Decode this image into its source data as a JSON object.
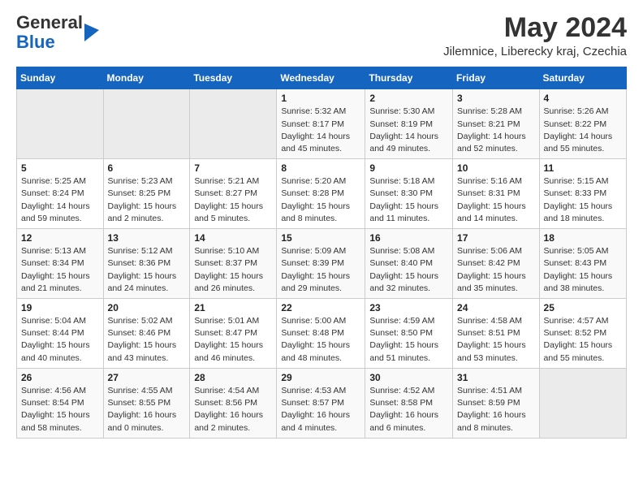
{
  "header": {
    "logo_general": "General",
    "logo_blue": "Blue",
    "month_year": "May 2024",
    "location": "Jilemnice, Liberecky kraj, Czechia"
  },
  "days_of_week": [
    "Sunday",
    "Monday",
    "Tuesday",
    "Wednesday",
    "Thursday",
    "Friday",
    "Saturday"
  ],
  "weeks": [
    [
      {
        "day": "",
        "info": ""
      },
      {
        "day": "",
        "info": ""
      },
      {
        "day": "",
        "info": ""
      },
      {
        "day": "1",
        "info": "Sunrise: 5:32 AM\nSunset: 8:17 PM\nDaylight: 14 hours\nand 45 minutes."
      },
      {
        "day": "2",
        "info": "Sunrise: 5:30 AM\nSunset: 8:19 PM\nDaylight: 14 hours\nand 49 minutes."
      },
      {
        "day": "3",
        "info": "Sunrise: 5:28 AM\nSunset: 8:21 PM\nDaylight: 14 hours\nand 52 minutes."
      },
      {
        "day": "4",
        "info": "Sunrise: 5:26 AM\nSunset: 8:22 PM\nDaylight: 14 hours\nand 55 minutes."
      }
    ],
    [
      {
        "day": "5",
        "info": "Sunrise: 5:25 AM\nSunset: 8:24 PM\nDaylight: 14 hours\nand 59 minutes."
      },
      {
        "day": "6",
        "info": "Sunrise: 5:23 AM\nSunset: 8:25 PM\nDaylight: 15 hours\nand 2 minutes."
      },
      {
        "day": "7",
        "info": "Sunrise: 5:21 AM\nSunset: 8:27 PM\nDaylight: 15 hours\nand 5 minutes."
      },
      {
        "day": "8",
        "info": "Sunrise: 5:20 AM\nSunset: 8:28 PM\nDaylight: 15 hours\nand 8 minutes."
      },
      {
        "day": "9",
        "info": "Sunrise: 5:18 AM\nSunset: 8:30 PM\nDaylight: 15 hours\nand 11 minutes."
      },
      {
        "day": "10",
        "info": "Sunrise: 5:16 AM\nSunset: 8:31 PM\nDaylight: 15 hours\nand 14 minutes."
      },
      {
        "day": "11",
        "info": "Sunrise: 5:15 AM\nSunset: 8:33 PM\nDaylight: 15 hours\nand 18 minutes."
      }
    ],
    [
      {
        "day": "12",
        "info": "Sunrise: 5:13 AM\nSunset: 8:34 PM\nDaylight: 15 hours\nand 21 minutes."
      },
      {
        "day": "13",
        "info": "Sunrise: 5:12 AM\nSunset: 8:36 PM\nDaylight: 15 hours\nand 24 minutes."
      },
      {
        "day": "14",
        "info": "Sunrise: 5:10 AM\nSunset: 8:37 PM\nDaylight: 15 hours\nand 26 minutes."
      },
      {
        "day": "15",
        "info": "Sunrise: 5:09 AM\nSunset: 8:39 PM\nDaylight: 15 hours\nand 29 minutes."
      },
      {
        "day": "16",
        "info": "Sunrise: 5:08 AM\nSunset: 8:40 PM\nDaylight: 15 hours\nand 32 minutes."
      },
      {
        "day": "17",
        "info": "Sunrise: 5:06 AM\nSunset: 8:42 PM\nDaylight: 15 hours\nand 35 minutes."
      },
      {
        "day": "18",
        "info": "Sunrise: 5:05 AM\nSunset: 8:43 PM\nDaylight: 15 hours\nand 38 minutes."
      }
    ],
    [
      {
        "day": "19",
        "info": "Sunrise: 5:04 AM\nSunset: 8:44 PM\nDaylight: 15 hours\nand 40 minutes."
      },
      {
        "day": "20",
        "info": "Sunrise: 5:02 AM\nSunset: 8:46 PM\nDaylight: 15 hours\nand 43 minutes."
      },
      {
        "day": "21",
        "info": "Sunrise: 5:01 AM\nSunset: 8:47 PM\nDaylight: 15 hours\nand 46 minutes."
      },
      {
        "day": "22",
        "info": "Sunrise: 5:00 AM\nSunset: 8:48 PM\nDaylight: 15 hours\nand 48 minutes."
      },
      {
        "day": "23",
        "info": "Sunrise: 4:59 AM\nSunset: 8:50 PM\nDaylight: 15 hours\nand 51 minutes."
      },
      {
        "day": "24",
        "info": "Sunrise: 4:58 AM\nSunset: 8:51 PM\nDaylight: 15 hours\nand 53 minutes."
      },
      {
        "day": "25",
        "info": "Sunrise: 4:57 AM\nSunset: 8:52 PM\nDaylight: 15 hours\nand 55 minutes."
      }
    ],
    [
      {
        "day": "26",
        "info": "Sunrise: 4:56 AM\nSunset: 8:54 PM\nDaylight: 15 hours\nand 58 minutes."
      },
      {
        "day": "27",
        "info": "Sunrise: 4:55 AM\nSunset: 8:55 PM\nDaylight: 16 hours\nand 0 minutes."
      },
      {
        "day": "28",
        "info": "Sunrise: 4:54 AM\nSunset: 8:56 PM\nDaylight: 16 hours\nand 2 minutes."
      },
      {
        "day": "29",
        "info": "Sunrise: 4:53 AM\nSunset: 8:57 PM\nDaylight: 16 hours\nand 4 minutes."
      },
      {
        "day": "30",
        "info": "Sunrise: 4:52 AM\nSunset: 8:58 PM\nDaylight: 16 hours\nand 6 minutes."
      },
      {
        "day": "31",
        "info": "Sunrise: 4:51 AM\nSunset: 8:59 PM\nDaylight: 16 hours\nand 8 minutes."
      },
      {
        "day": "",
        "info": ""
      }
    ]
  ]
}
